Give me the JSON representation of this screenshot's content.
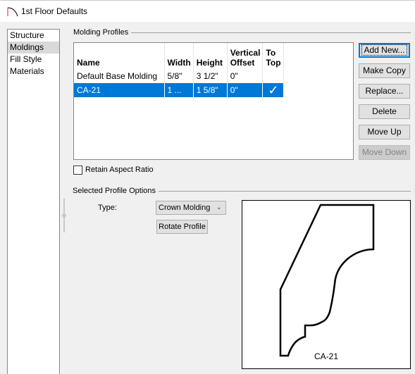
{
  "window": {
    "title": "1st Floor Defaults",
    "icon": "arc-icon"
  },
  "sidebar": {
    "items": [
      {
        "label": "Structure",
        "selected": false
      },
      {
        "label": "Moldings",
        "selected": true
      },
      {
        "label": "Fill Style",
        "selected": false
      },
      {
        "label": "Materials",
        "selected": false
      }
    ]
  },
  "molding_profiles": {
    "group_label": "Molding Profiles",
    "columns": [
      "Name",
      "Width",
      "Height",
      "Vertical Offset",
      "To Top"
    ],
    "column_lines": [
      [
        "",
        "Name"
      ],
      [
        "",
        "Width"
      ],
      [
        "",
        "Height"
      ],
      [
        "Vertical",
        "Offset"
      ],
      [
        "To",
        "Top"
      ]
    ],
    "rows": [
      {
        "name": "Default Base Molding",
        "width": "5/8\"",
        "height": "3 1/2\"",
        "vertical_offset": "0\"",
        "to_top": "",
        "selected": false
      },
      {
        "name": "CA-21",
        "width": "1 ...",
        "height": "1 5/8\"",
        "vertical_offset": "0\"",
        "to_top": "✓",
        "selected": true
      }
    ]
  },
  "buttons": {
    "add_new": "Add New...",
    "make_copy": "Make Copy",
    "replace": "Replace...",
    "delete": "Delete",
    "move_up": "Move Up",
    "move_down": "Move Down"
  },
  "retain_aspect_ratio": {
    "label": "Retain Aspect Ratio",
    "checked": false
  },
  "selected_profile_options": {
    "group_label": "Selected Profile Options",
    "type_label": "Type:",
    "type_value": "Crown Molding",
    "rotate_button": "Rotate Profile",
    "preview_label": "CA-21"
  }
}
